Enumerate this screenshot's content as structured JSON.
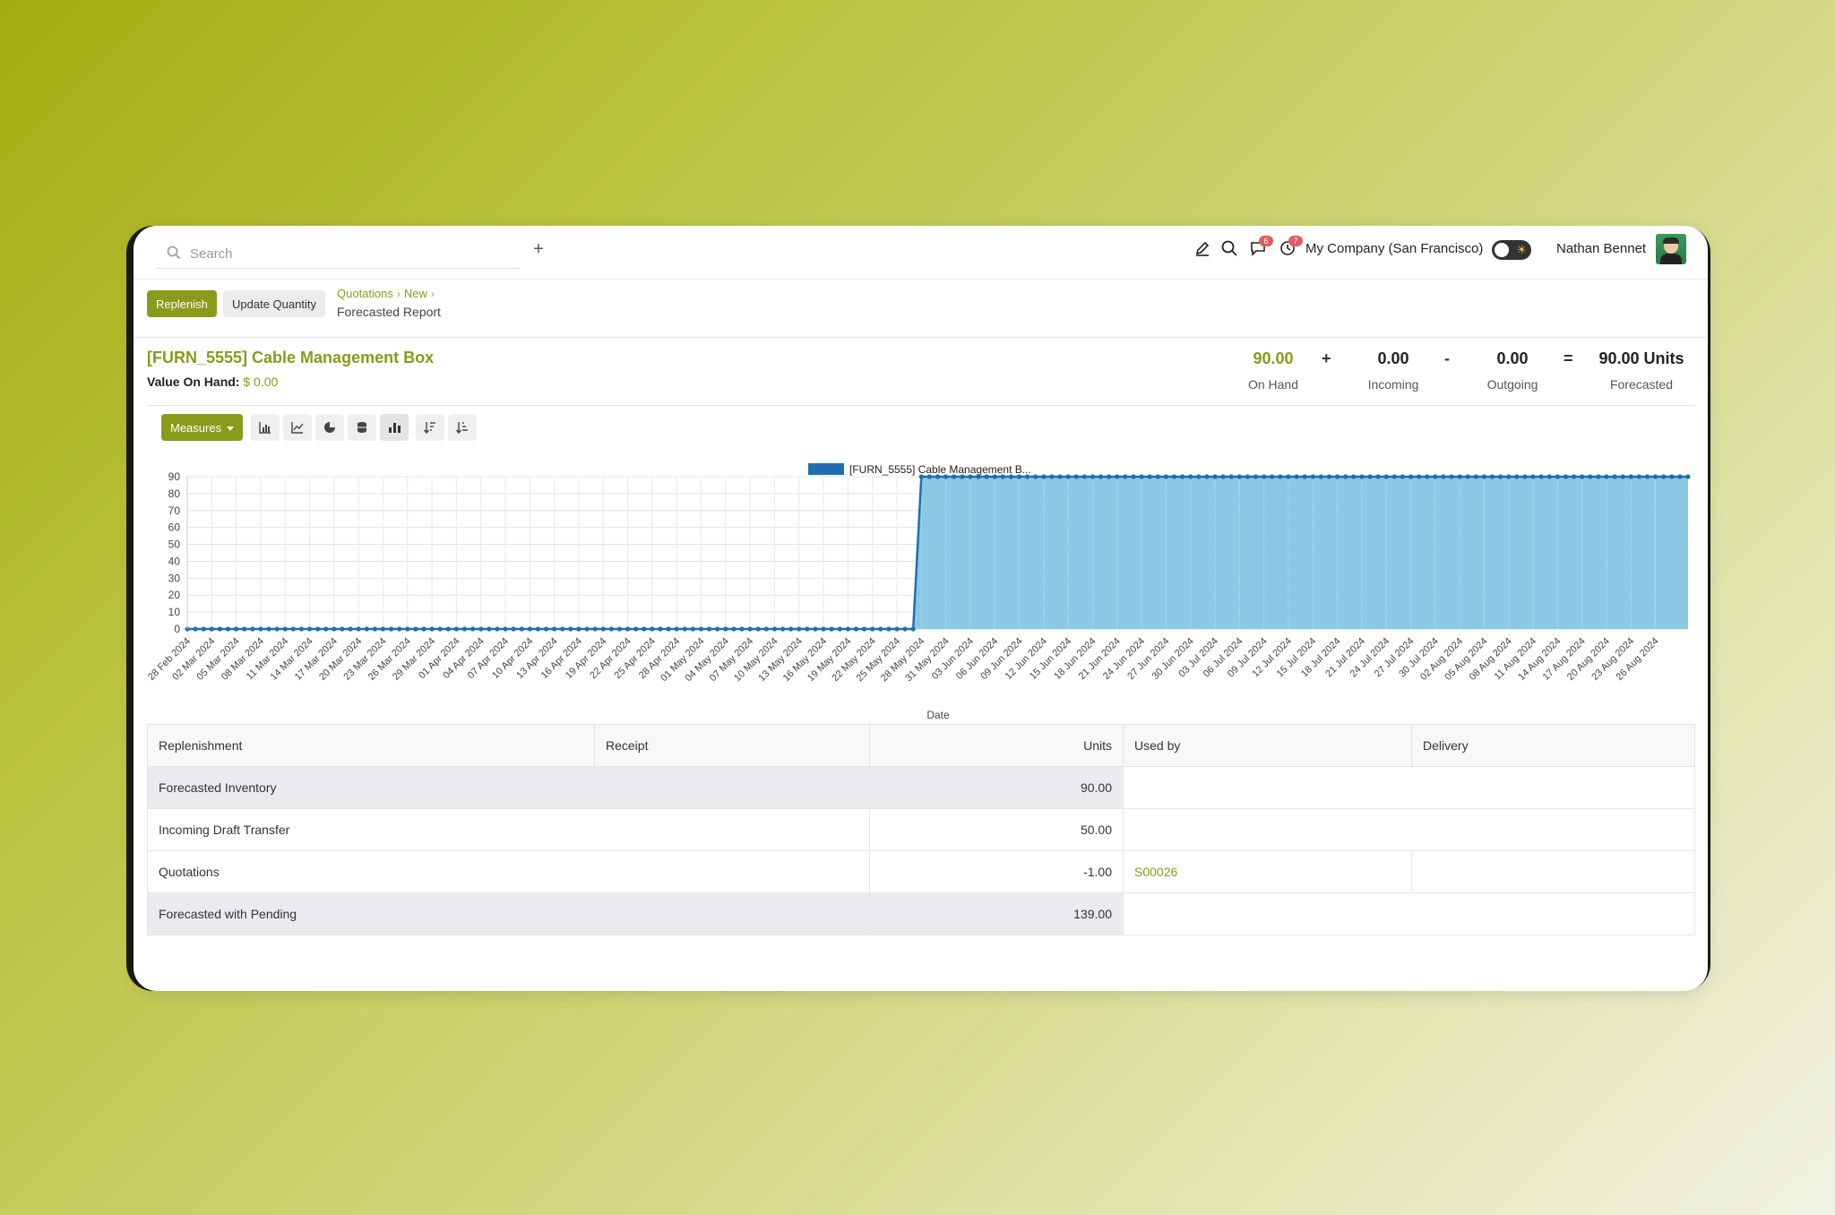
{
  "search": {
    "placeholder": "Search"
  },
  "topbar": {
    "add_symbol": "+",
    "messages_badge": "6",
    "activity_badge": "7",
    "company": "My Company (San Francisco)",
    "user": "Nathan Bennet"
  },
  "control": {
    "replenish_label": "Replenish",
    "update_qty_label": "Update Quantity",
    "breadcrumbs": [
      "Quotations",
      "New"
    ],
    "current": "Forecasted Report"
  },
  "product": {
    "title": "[FURN_5555] Cable Management Box",
    "value_label": "Value On Hand:",
    "value": "$ 0.00"
  },
  "stats": {
    "on_hand": {
      "value": "90.00",
      "label": "On Hand"
    },
    "incoming": {
      "value": "0.00",
      "label": "Incoming"
    },
    "outgoing": {
      "value": "0.00",
      "label": "Outgoing"
    },
    "forecasted": {
      "value": "90.00 Units",
      "label": "Forecasted"
    },
    "ops": [
      "+",
      "-",
      "="
    ]
  },
  "graph_toolbar": {
    "measures_label": "Measures",
    "icons": [
      "bar-chart-icon",
      "line-chart-icon",
      "pie-chart-icon",
      "stack-icon",
      "chart-mode-icon",
      "sort-descending-icon",
      "sort-ascending-icon"
    ]
  },
  "colors": {
    "accent": "#8a9a1b",
    "series": "#1f6fb0",
    "fill": "#7ec2e0"
  },
  "chart_data": {
    "type": "area",
    "legend": "[FURN_5555] Cable Management B...",
    "xlabel": "Date",
    "ylabel": "",
    "ylim": [
      0,
      90
    ],
    "yticks": [
      0,
      10,
      20,
      30,
      40,
      50,
      60,
      70,
      80,
      90
    ],
    "grid": true,
    "x_start": "2024-02-28",
    "x_end": "2024-08-30",
    "x_tick_labels": [
      "28 Feb 2024",
      "02 Mar 2024",
      "05 Mar 2024",
      "08 Mar 2024",
      "11 Mar 2024",
      "14 Mar 2024",
      "17 Mar 2024",
      "20 Mar 2024",
      "23 Mar 2024",
      "26 Mar 2024",
      "29 Mar 2024",
      "01 Apr 2024",
      "04 Apr 2024",
      "07 Apr 2024",
      "10 Apr 2024",
      "13 Apr 2024",
      "16 Apr 2024",
      "19 Apr 2024",
      "22 Apr 2024",
      "25 Apr 2024",
      "28 Apr 2024",
      "01 May 2024",
      "04 May 2024",
      "07 May 2024",
      "10 May 2024",
      "13 May 2024",
      "16 May 2024",
      "19 May 2024",
      "22 May 2024",
      "25 May 2024",
      "28 May 2024",
      "31 May 2024",
      "03 Jun 2024",
      "06 Jun 2024",
      "09 Jun 2024",
      "12 Jun 2024",
      "15 Jun 2024",
      "18 Jun 2024",
      "21 Jun 2024",
      "24 Jun 2024",
      "27 Jun 2024",
      "30 Jun 2024",
      "03 Jul 2024",
      "06 Jul 2024",
      "09 Jul 2024",
      "12 Jul 2024",
      "15 Jul 2024",
      "18 Jul 2024",
      "21 Jul 2024",
      "24 Jul 2024",
      "27 Jul 2024",
      "30 Jul 2024",
      "02 Aug 2024",
      "05 Aug 2024",
      "08 Aug 2024",
      "11 Aug 2024",
      "14 Aug 2024",
      "17 Aug 2024",
      "20 Aug 2024",
      "23 Aug 2024",
      "26 Aug 2024"
    ],
    "series": [
      {
        "name": "[FURN_5555] Cable Management B...",
        "segments": [
          {
            "from": "2024-02-28",
            "to": "2024-05-27",
            "value": 0
          },
          {
            "from": "2024-05-28",
            "to": "2024-08-30",
            "value": 90
          }
        ]
      }
    ]
  },
  "table": {
    "headers": [
      "Replenishment",
      "Receipt",
      "Units",
      "Used by",
      "Delivery"
    ],
    "rows": [
      {
        "label": "Forecasted Inventory",
        "units": "90.00",
        "used_by": "",
        "shaded": true
      },
      {
        "label": "Incoming Draft Transfer",
        "units": "50.00",
        "used_by": "",
        "shaded": false
      },
      {
        "label": "Quotations",
        "units": "-1.00",
        "used_by": "S00026",
        "shaded": false
      },
      {
        "label": "Forecasted with Pending",
        "units": "139.00",
        "used_by": "",
        "shaded": true
      }
    ]
  }
}
